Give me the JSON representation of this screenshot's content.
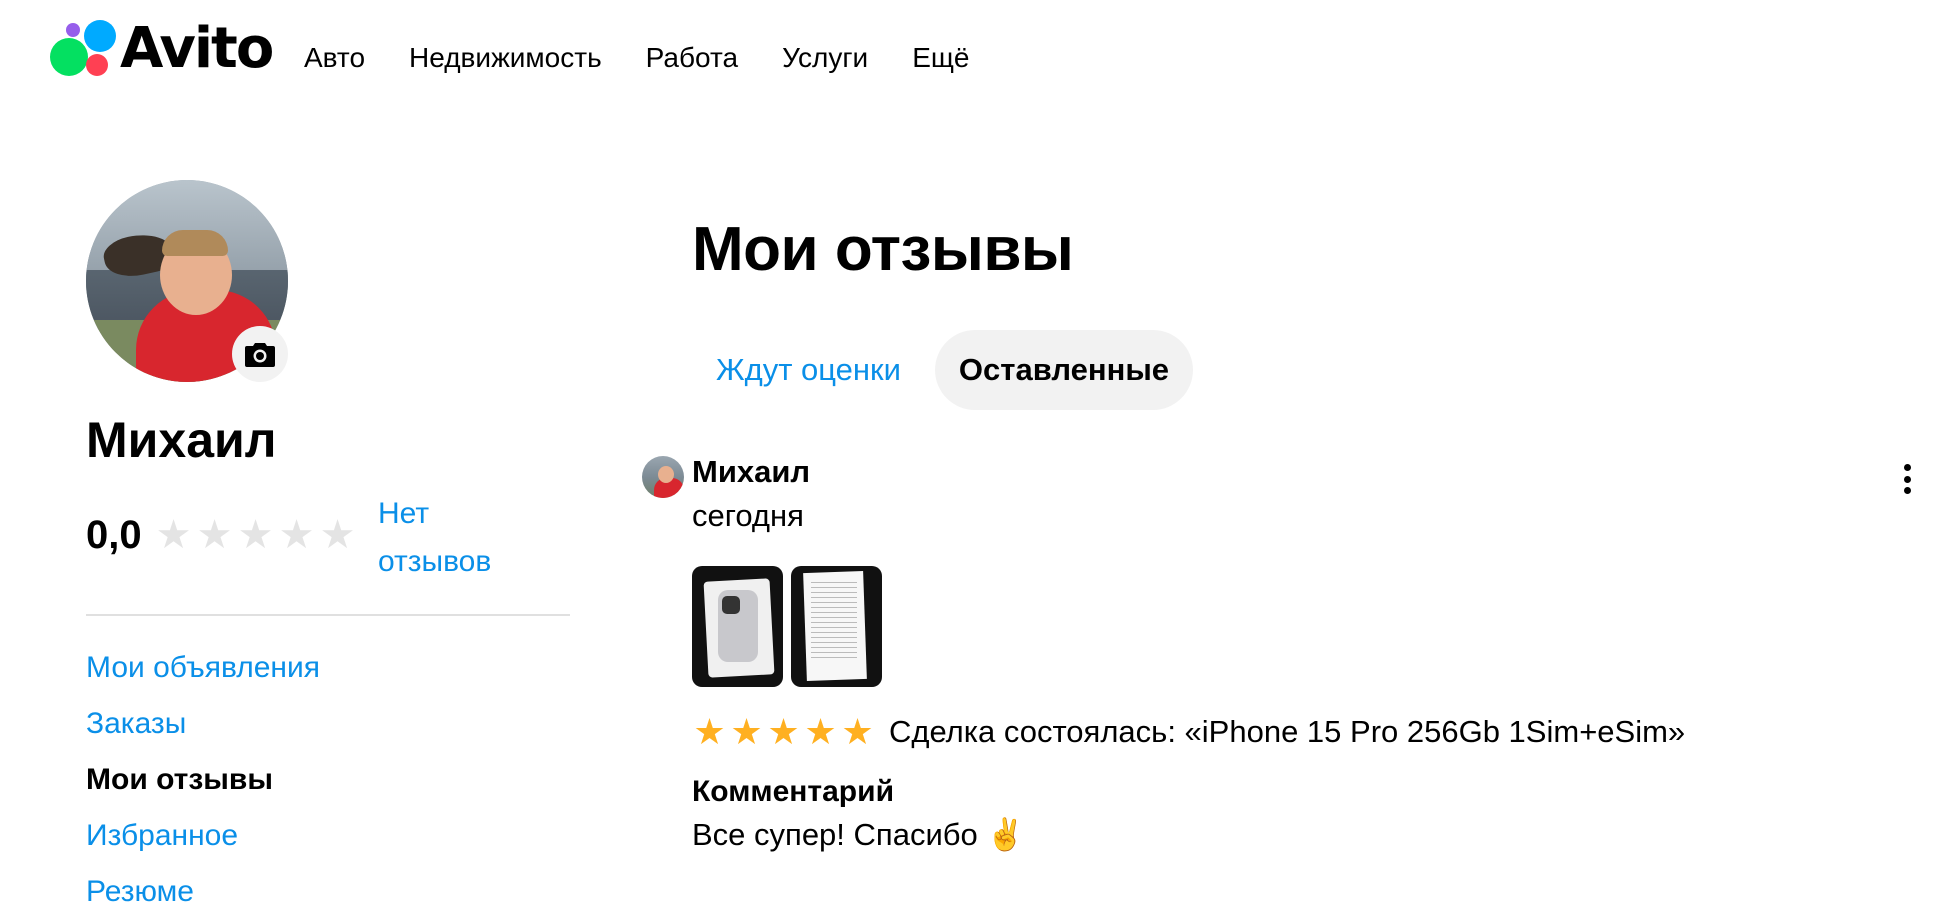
{
  "header": {
    "logo_text": "Avito",
    "nav": [
      "Авто",
      "Недвижимость",
      "Работа",
      "Услуги",
      "Ещё"
    ]
  },
  "profile": {
    "name": "Михаил",
    "rating": "0,0",
    "rating_stars_filled": 0,
    "rating_stars_total": 5,
    "no_reviews_link": "Нет отзывов",
    "camera_icon": "camera-icon"
  },
  "sidebar": {
    "items": [
      {
        "label": "Мои объявления",
        "active": false
      },
      {
        "label": "Заказы",
        "active": false
      },
      {
        "label": "Мои отзывы",
        "active": true
      },
      {
        "label": "Избранное",
        "active": false
      },
      {
        "label": "Резюме",
        "active": false
      }
    ]
  },
  "main": {
    "title": "Мои отзывы",
    "tabs": [
      {
        "label": "Ждут оценки",
        "active": false
      },
      {
        "label": "Оставленные",
        "active": true
      }
    ]
  },
  "review": {
    "author": "Михаил",
    "date": "сегодня",
    "photo_count": 2,
    "stars": 5,
    "deal_text": "Сделка состоялась: «iPhone 15 Pro 256Gb 1Sim+eSim»",
    "comment_title": "Комментарий",
    "comment_text": "Все супер! Спасибо ✌️",
    "more_icon": "more-vertical-icon"
  },
  "colors": {
    "link": "#0a8fe8",
    "star_filled": "#ffb021",
    "star_empty": "#e4e4e4",
    "tab_active_bg": "#f2f2f2"
  }
}
